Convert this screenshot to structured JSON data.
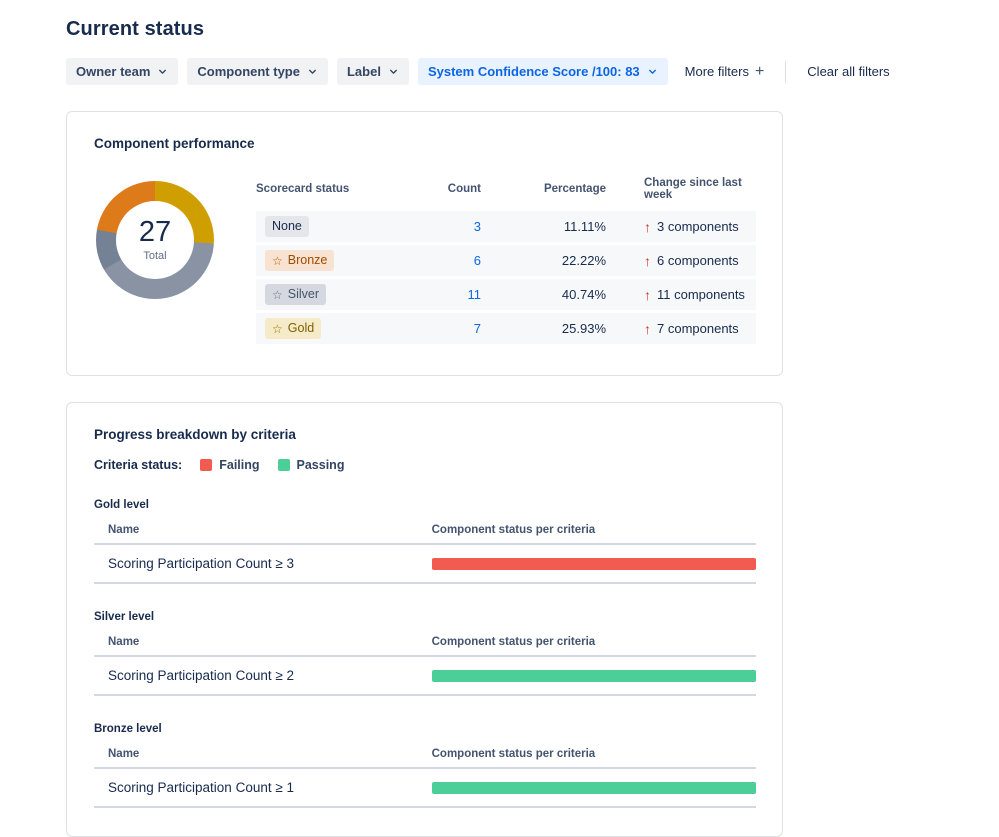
{
  "page": {
    "title": "Current status"
  },
  "filters": {
    "dropdowns": [
      {
        "label": "Owner team"
      },
      {
        "label": "Component type"
      },
      {
        "label": "Label"
      }
    ],
    "active_filter": {
      "label": "System Confidence Score /100: 83"
    },
    "more_filters": "More filters",
    "clear_all": "Clear all filters"
  },
  "chart_data": {
    "type": "pie",
    "title": "Component performance",
    "total": 27,
    "total_label": "Total",
    "segments": [
      {
        "label": "Gold",
        "value": 7,
        "color": "#CF9F02"
      },
      {
        "label": "Silver",
        "value": 11,
        "color": "#8993A4"
      },
      {
        "label": "None",
        "value": 3,
        "color": "#758195"
      },
      {
        "label": "Bronze",
        "value": 6,
        "color": "#DD7A1A"
      }
    ]
  },
  "performance_card": {
    "title": "Component performance",
    "table": {
      "headers": [
        "Scorecard status",
        "Count",
        "Percentage",
        "Change since last week"
      ],
      "rows": [
        {
          "status": "None",
          "count": "3",
          "percentage": "11.11%",
          "change": "3 components"
        },
        {
          "status": "Bronze",
          "count": "6",
          "percentage": "22.22%",
          "change": "6 components"
        },
        {
          "status": "Silver",
          "count": "11",
          "percentage": "40.74%",
          "change": "11 components"
        },
        {
          "status": "Gold",
          "count": "7",
          "percentage": "25.93%",
          "change": "7 components"
        }
      ]
    }
  },
  "progress_card": {
    "title": "Progress breakdown by criteria",
    "legend": {
      "label": "Criteria status:",
      "failing": "Failing",
      "passing": "Passing"
    },
    "colors": {
      "failing": "#F15B50",
      "passing": "#4BCE97"
    },
    "sections": [
      {
        "level": "Gold level",
        "name_header": "Name",
        "status_header": "Component status per criteria",
        "criteria": "Scoring Participation Count ≥ 3",
        "bar_status": "failing"
      },
      {
        "level": "Silver level",
        "name_header": "Name",
        "status_header": "Component status per criteria",
        "criteria": "Scoring Participation Count ≥ 2",
        "bar_status": "passing"
      },
      {
        "level": "Bronze level",
        "name_header": "Name",
        "status_header": "Component status per criteria",
        "criteria": "Scoring Participation Count ≥ 1",
        "bar_status": "passing"
      }
    ]
  }
}
